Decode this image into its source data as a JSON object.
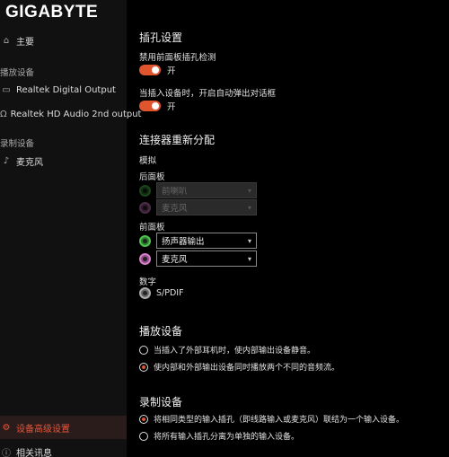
{
  "brand": {
    "logo": "GIGABYTE"
  },
  "sidebar": {
    "main": {
      "label": "主要",
      "icon": "home-icon"
    },
    "playback_header": "播放设备",
    "playback_items": [
      {
        "label": "Realtek Digital Output",
        "icon": "speaker-icon"
      },
      {
        "label": "Realtek HD Audio 2nd output",
        "icon": "headphones-icon"
      }
    ],
    "recording_header": "录制设备",
    "recording_items": [
      {
        "label": "麦克风",
        "icon": "microphone-icon"
      }
    ],
    "advanced": {
      "label": "设备高级设置",
      "icon": "gear-icon"
    },
    "info": {
      "label": "相关讯息",
      "icon": "info-icon"
    }
  },
  "jack_settings": {
    "title": "插孔设置",
    "disable_front_panel": {
      "label": "禁用前面板插孔检测",
      "state": "开",
      "on": true
    },
    "auto_popup": {
      "label": "当插入设备时，开启自动弹出对话框",
      "state": "开",
      "on": true
    }
  },
  "connector": {
    "title": "连接器重新分配",
    "analog_label": "模拟",
    "back_panel": {
      "label": "后面板",
      "jacks": [
        {
          "color": "green",
          "value": "前喇叭",
          "disabled": true
        },
        {
          "color": "pink",
          "value": "麦克风",
          "disabled": true
        }
      ]
    },
    "front_panel": {
      "label": "前面板",
      "jacks": [
        {
          "color": "green",
          "value": "扬声器输出",
          "disabled": false
        },
        {
          "color": "pink",
          "value": "麦克风",
          "disabled": false
        }
      ]
    },
    "digital_label": "数字",
    "digital_jack": {
      "color": "gray",
      "label": "S/PDIF"
    }
  },
  "playback": {
    "title": "播放设备",
    "options": [
      {
        "label": "当插入了外部耳机时，使内部输出设备静音。",
        "selected": false
      },
      {
        "label": "使内部和外部输出设备同时播放两个不同的音频流。",
        "selected": true
      }
    ]
  },
  "recording": {
    "title": "录制设备",
    "options": [
      {
        "label": "将相同类型的输入插孔（即线路输入或麦克风）联结为一个输入设备。",
        "selected": true
      },
      {
        "label": "将所有输入插孔分离为单独的输入设备。",
        "selected": false
      }
    ]
  },
  "colors": {
    "accent": "#e0542e",
    "sidebar_bg": "#111111",
    "main_bg": "#000000"
  }
}
